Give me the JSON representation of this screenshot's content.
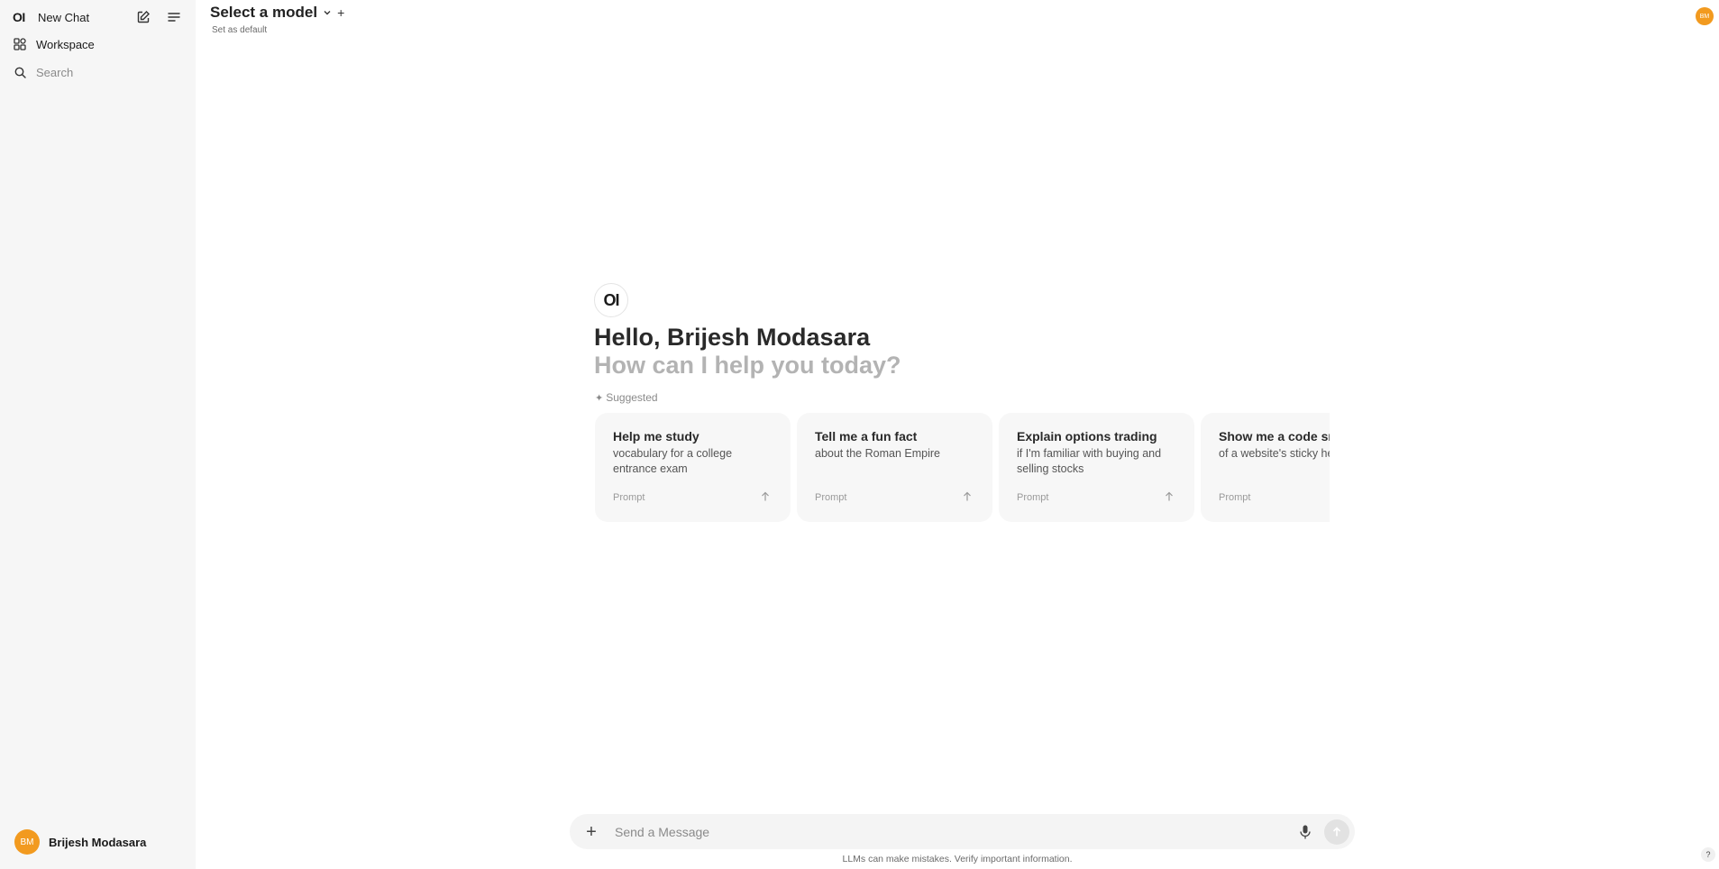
{
  "sidebar": {
    "logo": "OI",
    "new_chat_label": "New Chat",
    "workspace_label": "Workspace",
    "search_placeholder": "Search",
    "user": {
      "initials": "BM",
      "name": "Brijesh Modasara"
    }
  },
  "header": {
    "model_title": "Select a model",
    "set_default": "Set as default",
    "avatar_initials": "BM"
  },
  "main": {
    "logo": "OI",
    "greeting": "Hello, Brijesh Modasara",
    "subgreeting": "How can I help you today?",
    "suggested_label": "Suggested",
    "suggestions": [
      {
        "title": "Help me study",
        "subtitle": "vocabulary for a college entrance exam",
        "footer": "Prompt"
      },
      {
        "title": "Tell me a fun fact",
        "subtitle": "about the Roman Empire",
        "footer": "Prompt"
      },
      {
        "title": "Explain options trading",
        "subtitle": "if I'm familiar with buying and selling stocks",
        "footer": "Prompt"
      },
      {
        "title": "Show me a code snippet",
        "subtitle": "of a website's sticky header",
        "footer": "Prompt"
      }
    ]
  },
  "composer": {
    "placeholder": "Send a Message",
    "disclaimer": "LLMs can make mistakes. Verify important information."
  },
  "help_label": "?",
  "colors": {
    "avatar": "#f29a1f",
    "sidebar_bg": "#f6f6f6",
    "card_bg": "#f7f7f7"
  }
}
